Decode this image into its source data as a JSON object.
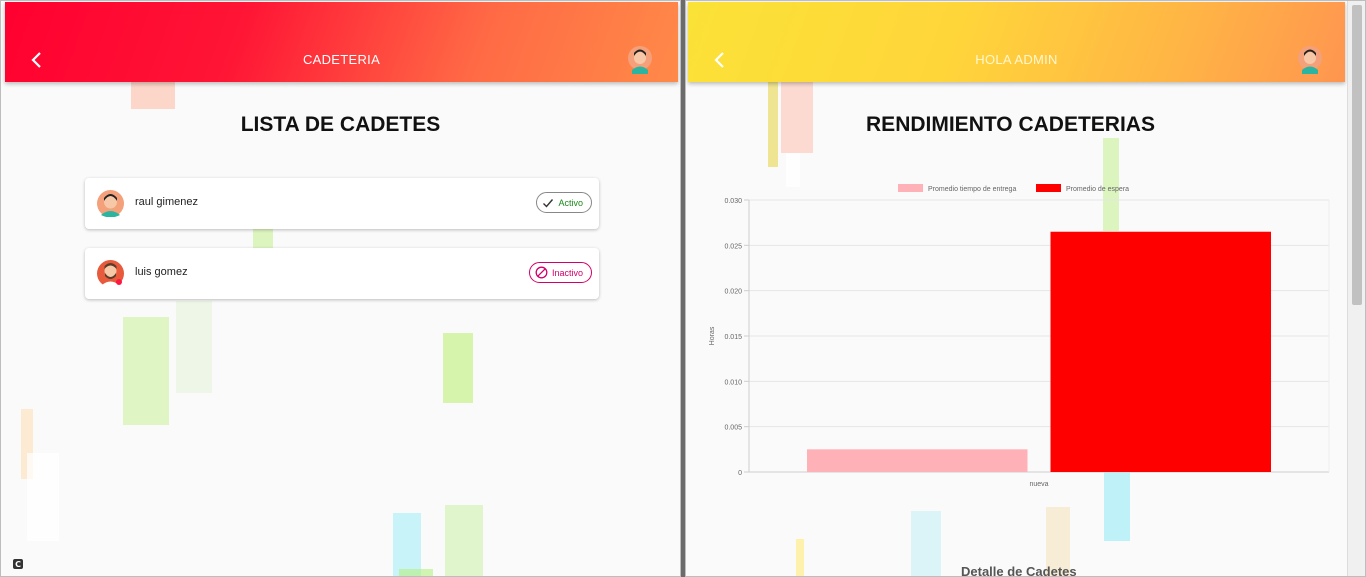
{
  "left": {
    "title": "CADETERIA",
    "heading": "LISTA DE CADETES",
    "cadetes": [
      {
        "name": "raul gimenez",
        "status": "Activo"
      },
      {
        "name": "luis gomez",
        "status": "Inactivo"
      }
    ],
    "corner_badge": "C"
  },
  "right": {
    "title": "HOLA ADMIN",
    "heading": "RENDIMIENTO CADETERIAS",
    "subtitle": "Detalle de Cadetes"
  },
  "colors": {
    "left_bar_start": "#ff0030",
    "left_bar_end": "#ff8a48",
    "right_bar_start": "#fbe237",
    "right_bar_end": "#ff9550",
    "active": "#1a8a1a",
    "inactive": "#d1006a"
  },
  "icons": {
    "back": "chevron-left-icon",
    "avatar": "user-avatar-icon",
    "active": "check-icon",
    "inactive": "block-icon"
  },
  "chart_data": {
    "type": "bar",
    "categories": [
      "nueva"
    ],
    "series": [
      {
        "name": "Promedio tiempo de entrega",
        "values": [
          0.0025
        ],
        "color": "#ffb1b8"
      },
      {
        "name": "Promedio de espera",
        "values": [
          0.0265
        ],
        "color": "#ff0000"
      }
    ],
    "ylabel": "Horas",
    "xlabel": "",
    "ylim": [
      0,
      0.03
    ],
    "yticks": [
      "0",
      "0.005",
      "0.010",
      "0.015",
      "0.020",
      "0.025",
      "0.030"
    ],
    "grid": true,
    "legend": "top"
  }
}
